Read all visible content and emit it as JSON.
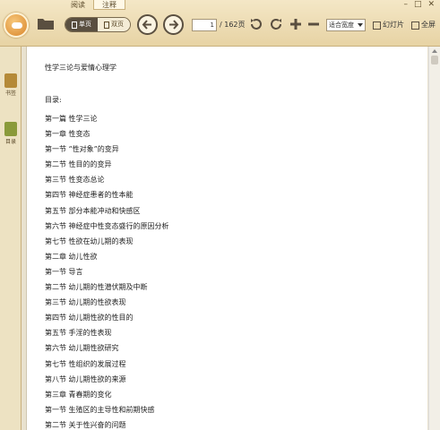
{
  "window": {
    "tabs": [
      {
        "label": "阅读",
        "active": false
      },
      {
        "label": "注释",
        "active": true
      }
    ],
    "controls": [
      "minimize",
      "maximize",
      "close"
    ]
  },
  "toolbar": {
    "open_icon": "folder-icon",
    "single_page_label": "单页",
    "double_page_label": "双页",
    "current_page": "1",
    "total_pages": "/ 162页",
    "fit_mode": "适合宽度",
    "slideshow_label": "幻灯片",
    "fullscreen_label": "全屏"
  },
  "sidebar": {
    "items": [
      {
        "label": "书签",
        "icon": "bookmark-icon"
      },
      {
        "label": "目录",
        "icon": "toc-icon"
      }
    ]
  },
  "document": {
    "title": "性学三论与爱情心理学",
    "toc_heading": "目录:",
    "toc": [
      "第一篇 性学三论",
      "第一章 性变态",
      "第一节 “性对象”的变异",
      "第二节 性目的的变异",
      "第三节 性变态总论",
      "第四节 神经症患者的性本能",
      "第五节 部分本能冲动和快感区",
      "第六节 神经症中性变态盛行的原因分析",
      "第七节 性欲在幼儿期的表现",
      "第二章 幼儿性欲",
      "第一节 导言",
      "第二节 幼儿期的性潜伏期及中断",
      "第三节 幼儿期的性欲表现",
      "第四节 幼儿期性欲的性目的",
      "第五节 手淫的性表现",
      "第六节 幼儿期性欲研究",
      "第七节 性组织的发展过程",
      "第八节 幼儿期性欲的来源",
      "第三章 青春期的变化",
      "第一节 生殖区的主导性和前期快感",
      "第二节 关于性兴奋的问题"
    ]
  },
  "colors": {
    "toolbar_bg": "#ecdcb2",
    "accent_dark": "#5a4f40",
    "page_bg": "#ffffff"
  }
}
